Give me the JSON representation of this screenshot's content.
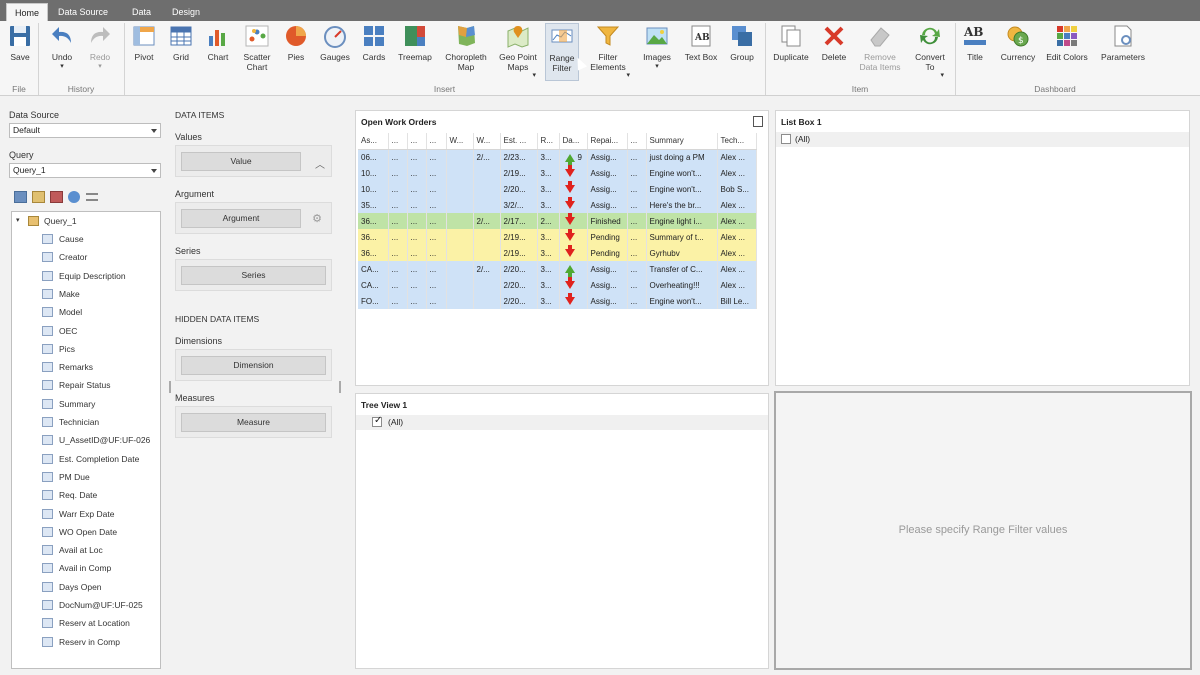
{
  "tabs": [
    "Home",
    "Data Source",
    "Data",
    "Design"
  ],
  "ribbon": {
    "save": "Save",
    "undo": "Undo",
    "redo": "Redo",
    "pivot": "Pivot",
    "grid": "Grid",
    "chart": "Chart",
    "scatter_chart": "Scatter Chart",
    "pies": "Pies",
    "gauges": "Gauges",
    "cards": "Cards",
    "treemap": "Treemap",
    "choropleth_map": "Choropleth Map",
    "geo_point_maps": "Geo Point Maps",
    "range_filter": "Range Filter",
    "filter_elements": "Filter Elements",
    "images": "Images",
    "text_box": "Text Box",
    "group": "Group",
    "duplicate": "Duplicate",
    "delete": "Delete",
    "remove_data_items": "Remove Data Items",
    "convert_to": "Convert To",
    "title": "Title",
    "currency": "Currency",
    "edit_colors": "Edit Colors",
    "parameters": "Parameters",
    "groups": {
      "file": "File",
      "history": "History",
      "insert": "Insert",
      "item": "Item",
      "dashboard": "Dashboard"
    }
  },
  "left": {
    "data_source_label": "Data Source",
    "data_source_value": "Default",
    "query_label": "Query",
    "query_value": "Query_1",
    "tree_root": "Query_1",
    "fields": [
      "Cause",
      "Creator",
      "Equip Description",
      "Make",
      "Model",
      "OEC",
      "Pics",
      "Remarks",
      "Repair Status",
      "Summary",
      "Technician",
      "U_AssetID@UF:UF-026",
      "Est. Completion Date",
      "PM Due",
      "Req. Date",
      "Warr Exp Date",
      "WO Open Date",
      "Avail at Loc",
      "Avail in Comp",
      "Days Open",
      "DocNum@UF:UF-025",
      "Reserv at Location",
      "Reserv in Comp"
    ]
  },
  "dataitems": {
    "header": "DATA ITEMS",
    "values_label": "Values",
    "value_btn": "Value",
    "argument_label": "Argument",
    "argument_btn": "Argument",
    "series_label": "Series",
    "series_btn": "Series",
    "hidden_header": "HIDDEN DATA ITEMS",
    "dimensions_label": "Dimensions",
    "dimension_btn": "Dimension",
    "measures_label": "Measures",
    "measure_btn": "Measure"
  },
  "grid": {
    "title": "Open Work Orders",
    "columns": [
      "As...",
      "...",
      "...",
      "...",
      "W...",
      "W...",
      "Est. ...",
      "R...",
      "Da...",
      "Repai...",
      "...",
      "Summary",
      "Tech..."
    ],
    "rows": [
      {
        "style": "blue",
        "arrow": "up",
        "cells": [
          "06...",
          "...",
          "...",
          "...",
          "",
          "2/...",
          "2/23...",
          "3...",
          "9",
          "Assig...",
          "...",
          "just doing a PM",
          "Alex ..."
        ]
      },
      {
        "style": "blue",
        "arrow": "down",
        "cells": [
          "10...",
          "...",
          "...",
          "...",
          "",
          "",
          "2/19...",
          "3...",
          "",
          "Assig...",
          "...",
          "Engine won't...",
          "Alex ..."
        ]
      },
      {
        "style": "blue",
        "arrow": "down",
        "cells": [
          "10...",
          "...",
          "...",
          "...",
          "",
          "",
          "2/20...",
          "3...",
          "",
          "Assig...",
          "...",
          "Engine won't...",
          "Bob S..."
        ]
      },
      {
        "style": "blue",
        "arrow": "down",
        "cells": [
          "35...",
          "...",
          "...",
          "...",
          "",
          "",
          "3/2/...",
          "3...",
          "",
          "Assig...",
          "...",
          "Here's the br...",
          "Alex ..."
        ]
      },
      {
        "style": "green",
        "arrow": "down",
        "cells": [
          "36...",
          "...",
          "...",
          "...",
          "",
          "2/...",
          "2/17...",
          "2...",
          "",
          "Finished",
          "...",
          "Engine light i...",
          "Alex ..."
        ]
      },
      {
        "style": "yellow",
        "arrow": "down",
        "cells": [
          "36...",
          "...",
          "...",
          "...",
          "",
          "",
          "2/19...",
          "3...",
          "",
          "Pending",
          "...",
          "Summary of t...",
          "Alex ..."
        ]
      },
      {
        "style": "yellow",
        "arrow": "down",
        "cells": [
          "36...",
          "...",
          "...",
          "...",
          "",
          "",
          "2/19...",
          "3...",
          "",
          "Pending",
          "...",
          "Gyrhubv",
          "Alex ..."
        ]
      },
      {
        "style": "blue",
        "arrow": "up",
        "cells": [
          "CA...",
          "...",
          "...",
          "...",
          "",
          "2/...",
          "2/20...",
          "3...",
          "",
          "Assig...",
          "...",
          "Transfer of C...",
          "Alex ..."
        ]
      },
      {
        "style": "blue",
        "arrow": "down",
        "cells": [
          "CA...",
          "...",
          "...",
          "...",
          "",
          "",
          "2/20...",
          "3...",
          "",
          "Assig...",
          "...",
          "Overheating!!!",
          "Alex ..."
        ]
      },
      {
        "style": "blue",
        "arrow": "down",
        "cells": [
          "FO...",
          "...",
          "...",
          "...",
          "",
          "",
          "2/20...",
          "3...",
          "",
          "Assig...",
          "...",
          "Engine won't...",
          "Bill Le..."
        ]
      }
    ]
  },
  "listbox": {
    "title": "List Box 1",
    "item": "(All)"
  },
  "treeview": {
    "title": "Tree View 1",
    "item": "(All)"
  },
  "rangefilter": {
    "message": "Please specify Range Filter values"
  },
  "colors": {
    "blue_row": "#cfe2f7",
    "green_row": "#bfe3a6",
    "yellow_row": "#fbf2a6",
    "down_arrow": "#e0221e",
    "up_arrow": "#4fa832"
  }
}
